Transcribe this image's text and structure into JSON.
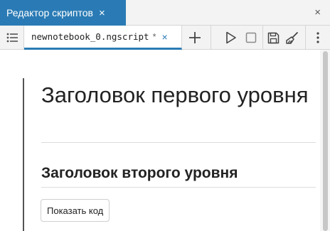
{
  "panel": {
    "title": "Редактор скриптов",
    "close_glyph": "×",
    "accent": "#2a7bb5"
  },
  "toolbar": {
    "file_tab": {
      "name": "newnotebook_0.ngscript",
      "modified_marker": "*",
      "close_glyph": "×"
    },
    "icons": [
      "list-icon",
      "plus-icon",
      "play-icon",
      "stop-icon",
      "save-icon",
      "brush-icon",
      "more-vertical-icon"
    ]
  },
  "content": {
    "heading1": "Заголовок первого уровня",
    "heading2": "Заголовок второго уровня",
    "show_code_label": "Показать код"
  }
}
